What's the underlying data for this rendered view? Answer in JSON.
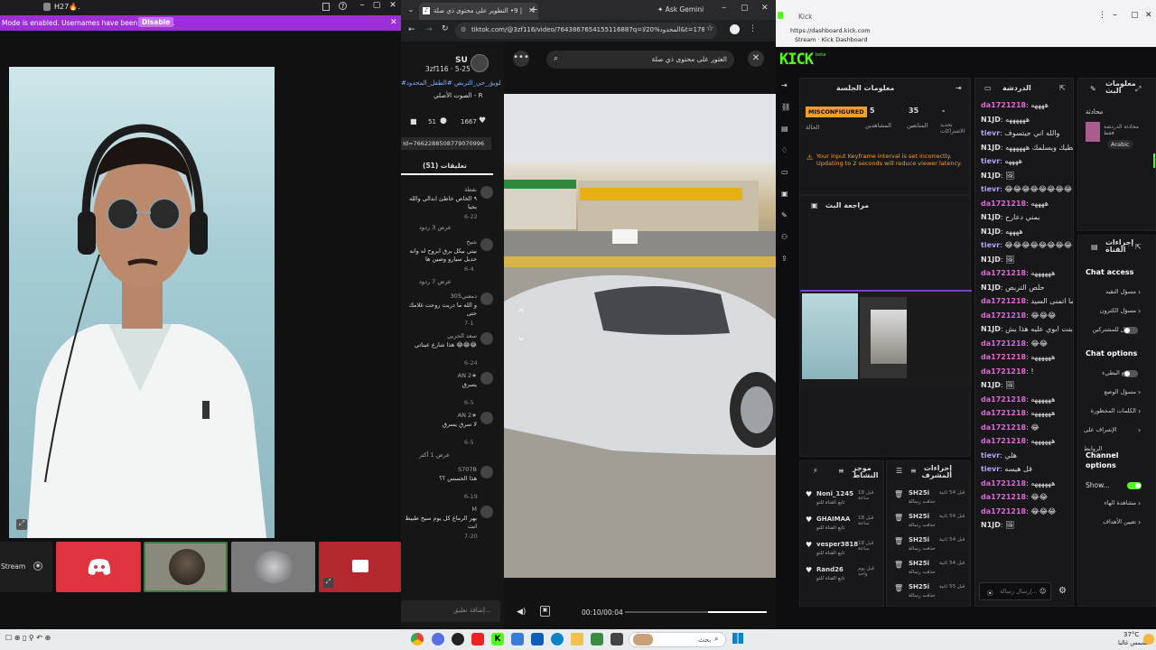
{
  "left": {
    "topbar_title": "H27🔥.",
    "notice": "Mode is enabled. Usernames have been truncated.",
    "disable_label": "Disable",
    "stream_label": "Stream"
  },
  "tiktok": {
    "tab_title": "متابعة تيك توك | 9• التطوير على محتوى ذي صلة...",
    "ask_gemini": "Ask Gemini",
    "url": "tiktok.com/@3zf116/video/7643867654155116887q=المحدود%20لا&t=178...",
    "search_placeholder": "العثور على محتوى ذي صلة",
    "author": "SU",
    "author_handle": "3zf116 · 5-25",
    "caption": "#تطويق_حي_التربص #الطفل_المحدود",
    "sound": "الصوت الأصلي - R",
    "likes": "1667",
    "comments": "51",
    "video_id": "Id=7662288508779070996",
    "comments_tab": "تعليقات (51)",
    "time": "00:10/00:04",
    "comment_input": "إضافة تعليق...",
    "comment_list": [
      {
        "user": "نقطة",
        "text": "٩ الخاص خاطئ ابدالي والله يجيا",
        "meta": "6-22"
      },
      {
        "user": "",
        "text": "",
        "meta": "عرض 3 ردود"
      },
      {
        "user": "شيخ",
        "text": "بيتي بيكل برق ابروح له وانه حديل سيارو وصين ها",
        "meta": "6-4"
      },
      {
        "user": "",
        "text": "",
        "meta": "عرض 7 ردود"
      },
      {
        "user": "دمعتي305",
        "text": "و الله ما دريت روحت غلامك حتى",
        "meta": "7-1"
      },
      {
        "user": "سعد الحربي",
        "text": "هذا شارع عيناتي 😂😂😂",
        "meta": "6-24"
      },
      {
        "user": "AN 2★",
        "text": "يسرق",
        "meta": "6-5"
      },
      {
        "user": "AN 2★",
        "text": "لا سرق يسرق",
        "meta": "6-5"
      },
      {
        "user": "",
        "text": "",
        "meta": "عرض 1 أكثر"
      },
      {
        "user": "S707B",
        "text": "هذا الخسس ؟؟",
        "meta": "6-19"
      },
      {
        "user": "M",
        "text": "بهر الرماع كل يوم سيح طبيط انت",
        "meta": "7-20"
      }
    ]
  },
  "kick": {
    "url": "https://dashboard.kick.com",
    "page_title": "Stream · Kick Dashboard",
    "logo": "KICK",
    "logo_badge": "beta",
    "session_title": "معلومات الجلسة",
    "status_badge": "MISCONFIGURED",
    "stat_viewers": "5",
    "stat_followers": "35",
    "stat_subs": "-",
    "stat_viewers_label": "المشاهدين",
    "stat_followers_label": "المتابعين",
    "stat_subs_label": "تحديد الاشتراكات",
    "status_label": "الحالة",
    "warning": "Your input Keyframe interval is set incorrectly. Updating to 2 seconds will reduce viewer latency.",
    "preview_title": "مراجعة البث",
    "activity_title": "موجز النشاط",
    "mod_actions_title": "إجراءات المشرف",
    "chat_title": "الدردشة",
    "chat_input": "إرسال رسالة...",
    "stream_info_title": "معلومات البث",
    "category": "Arabic",
    "stream_info_line": "محادثة",
    "channel_actions_title": "إجراءات القناة",
    "chat_access": "Chat access",
    "chat_options": "Chat options",
    "channel_options": "Channel options",
    "show_label": "Show...",
    "activity": [
      {
        "user": "Noni_1245",
        "action": "تابع القناة للتو",
        "time": "قبل 18 ساعة"
      },
      {
        "user": "GHAIMAA",
        "action": "تابع القناة للتو",
        "time": "قبل 18 ساعة"
      },
      {
        "user": "vesper3818",
        "action": "تابع القناة للتو",
        "time": "قبل 18 ساعة"
      },
      {
        "user": "Rand26",
        "action": "تابع القناة للتو",
        "time": "قبل يوم واحد"
      }
    ],
    "mod_actions": [
      {
        "user": "SH25i",
        "action": "حذفت رسالة",
        "time": "قبل 54 ثانية"
      },
      {
        "user": "SH25i",
        "action": "حذفت رسالة",
        "time": "قبل 54 ثانية"
      },
      {
        "user": "SH25i",
        "action": "حذفت رسالة",
        "time": "قبل 54 ثانية"
      },
      {
        "user": "SH25i",
        "action": "حذفت رسالة",
        "time": "قبل 54 ثانية"
      },
      {
        "user": "SH25i",
        "action": "حذفت رسالة",
        "time": "قبل 55 ثانية"
      }
    ],
    "chat": [
      {
        "user": "da1721218",
        "msg": "ههههه",
        "cls": "u1"
      },
      {
        "user": "N1JD",
        "msg": "ههههههه",
        "cls": "u3"
      },
      {
        "user": "tievr",
        "msg": "والله اني جيتسوف",
        "cls": "u2"
      },
      {
        "user": "N1JD",
        "msg": "الله يعطيك ويسلمك ههههههه",
        "cls": "u3"
      },
      {
        "user": "tievr",
        "msg": "ههههه",
        "cls": "u2"
      },
      {
        "user": "N1JD",
        "msg": "🖼",
        "cls": "u3"
      },
      {
        "user": "tievr",
        "msg": "😂😂😂😂😂😂😂😂",
        "cls": "u2"
      },
      {
        "user": "da1721218",
        "msg": "ههههه",
        "cls": "u1"
      },
      {
        "user": "N1JD",
        "msg": "يمني دعارح",
        "cls": "u3"
      },
      {
        "user": "N1JD",
        "msg": "ههههه",
        "cls": "u3"
      },
      {
        "user": "tievr",
        "msg": "😂😂😂😂😂😂😂😂",
        "cls": "u2"
      },
      {
        "user": "N1JD",
        "msg": "🖼",
        "cls": "u3"
      },
      {
        "user": "da1721218",
        "msg": "ههههههه",
        "cls": "u1"
      },
      {
        "user": "N1JD",
        "msg": "حلص التربص",
        "cls": "u3"
      },
      {
        "user": "da1721218",
        "msg": "ما اتمنى السيد",
        "cls": "u1"
      },
      {
        "user": "da1721218",
        "msg": "😂😂😂",
        "cls": "u1"
      },
      {
        "user": "N1JD",
        "msg": "والله بنت ابوي عليه هذا يش",
        "cls": "u3"
      },
      {
        "user": "da1721218",
        "msg": "😂😂",
        "cls": "u1"
      },
      {
        "user": "da1721218",
        "msg": "ههههههه",
        "cls": "u1"
      },
      {
        "user": "da1721218",
        "msg": "!",
        "cls": "u1"
      },
      {
        "user": "N1JD",
        "msg": "🖼",
        "cls": "u3"
      },
      {
        "user": "da1721218",
        "msg": "ههههههه",
        "cls": "u1"
      },
      {
        "user": "da1721218",
        "msg": "ههههههه",
        "cls": "u1"
      },
      {
        "user": "da1721218",
        "msg": "😂",
        "cls": "u1"
      },
      {
        "user": "da1721218",
        "msg": "ههههههه",
        "cls": "u1"
      },
      {
        "user": "tievr",
        "msg": "هلي",
        "cls": "u2"
      },
      {
        "user": "tievr",
        "msg": "قل هيسه",
        "cls": "u2"
      },
      {
        "user": "da1721218",
        "msg": "ههههههه",
        "cls": "u1"
      },
      {
        "user": "da1721218",
        "msg": "😂😂",
        "cls": "u1"
      },
      {
        "user": "da1721218",
        "msg": "😂😂😂",
        "cls": "u1"
      },
      {
        "user": "N1JD",
        "msg": "🖼",
        "cls": "u3"
      }
    ],
    "settings_access": [
      {
        "label": "مسؤل التقيد"
      },
      {
        "label": "مسؤل الكترون"
      },
      {
        "label": "الطول للمشتركين"
      }
    ],
    "settings_options": [
      {
        "label": "الوضع البطيء"
      },
      {
        "label": "مسؤل الوضع"
      },
      {
        "label": "الكلمات المحظورة"
      },
      {
        "label": "الإشراف على الروابط"
      }
    ],
    "settings_channel": [
      {
        "label": "مشاهدة الهاء"
      },
      {
        "label": "تعيين الأهداف"
      }
    ]
  },
  "taskbar": {
    "search": "بحث",
    "weather": "37°C",
    "weather_sub": "مشمس غالبا"
  },
  "colors": {
    "kick_green": "#53fc18",
    "notice_purple": "#9c2fd6",
    "discord_red": "#e0333f"
  }
}
